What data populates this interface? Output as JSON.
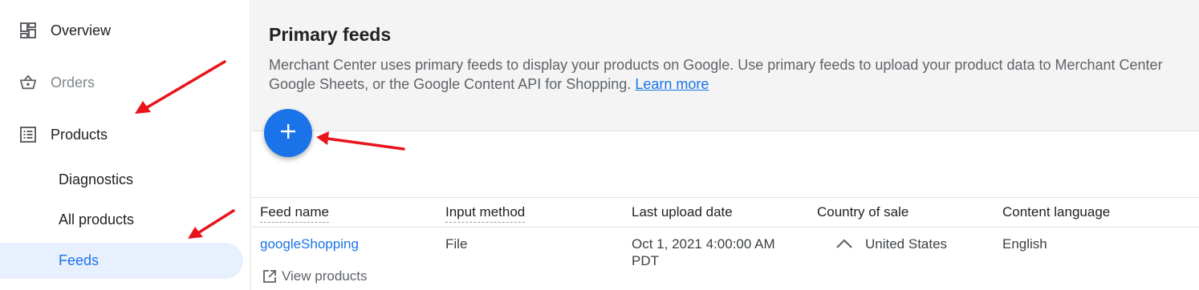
{
  "sidebar": {
    "items": [
      {
        "label": "Overview",
        "icon": "dashboard-icon"
      },
      {
        "label": "Orders",
        "icon": "basket-icon"
      },
      {
        "label": "Products",
        "icon": "list-icon"
      }
    ],
    "subitems": [
      {
        "label": "Diagnostics"
      },
      {
        "label": "All products"
      },
      {
        "label": "Feeds",
        "selected": true
      }
    ]
  },
  "main": {
    "title": "Primary feeds",
    "description_line1": "Merchant Center uses primary feeds to display your products on Google. Use primary feeds to upload your product data to Merchant Center",
    "description_line2": "Google Sheets, or the Google Content API for Shopping.",
    "learn_more": "Learn more",
    "add_button_icon": "plus-icon"
  },
  "table": {
    "columns": [
      "Feed name",
      "Input method",
      "Last upload date",
      "Country of sale",
      "Content language"
    ],
    "rows": [
      {
        "feed_name": "googleShopping",
        "input_method": "File",
        "last_upload_line1": "Oct 1, 2021 4:00:00 AM",
        "last_upload_line2": "PDT",
        "country": "United States",
        "language": "English",
        "view_products": "View products"
      }
    ]
  },
  "colors": {
    "accent": "#1a73e8",
    "selected_bg": "#e8f0fe",
    "annotation_arrow": "#e8141c"
  }
}
